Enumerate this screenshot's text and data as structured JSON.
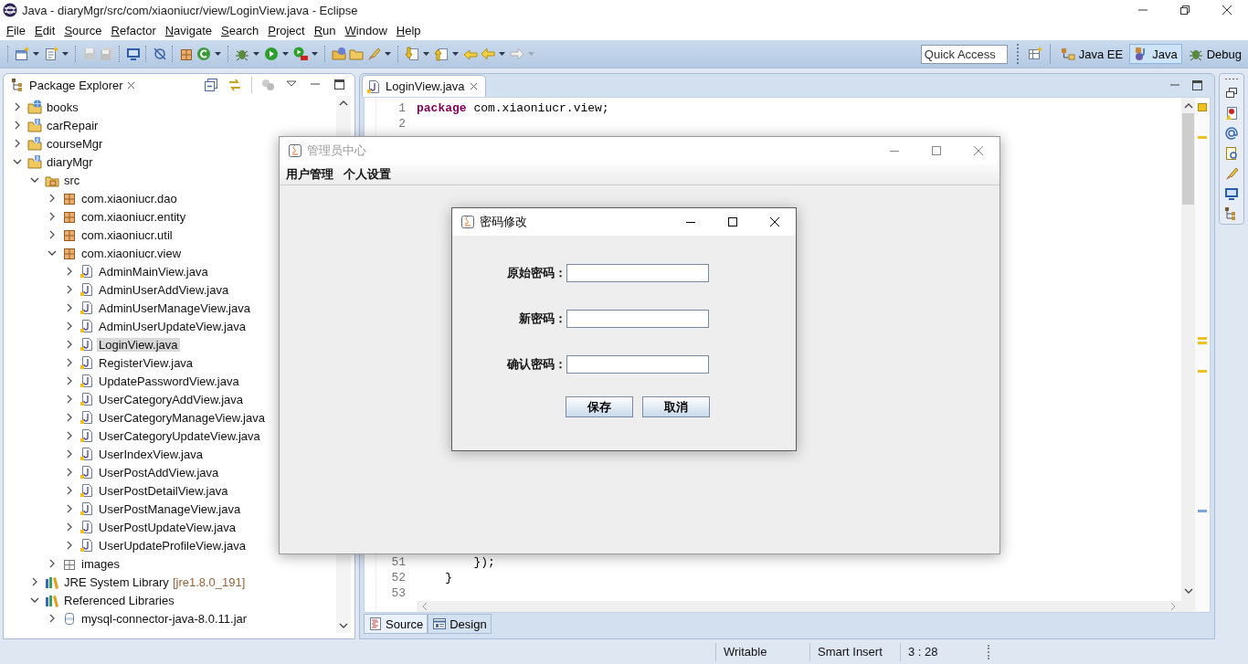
{
  "window": {
    "title": "Java - diaryMgr/src/com/xiaoniucr/view/LoginView.java - Eclipse"
  },
  "menu": [
    "File",
    "Edit",
    "Source",
    "Refactor",
    "Navigate",
    "Search",
    "Project",
    "Run",
    "Window",
    "Help"
  ],
  "quick_access": {
    "placeholder": "Quick Access"
  },
  "perspectives": [
    {
      "label": "Java EE",
      "kind": "javaee",
      "selected": false
    },
    {
      "label": "Java",
      "kind": "java",
      "selected": true
    },
    {
      "label": "Debug",
      "kind": "debug",
      "selected": false
    }
  ],
  "package_explorer": {
    "title": "Package Explorer",
    "tree": [
      {
        "label": "books",
        "kind": "web-project",
        "expanded": false,
        "selected": false
      },
      {
        "label": "carRepair",
        "kind": "project",
        "expanded": false,
        "selected": false
      },
      {
        "label": "courseMgr",
        "kind": "project",
        "expanded": false,
        "selected": false
      },
      {
        "label": "diaryMgr",
        "kind": "project",
        "expanded": true,
        "selected": false,
        "children": [
          {
            "label": "src",
            "kind": "source-folder",
            "expanded": true,
            "selected": false,
            "children": [
              {
                "label": "com.xiaoniucr.dao",
                "kind": "package",
                "expanded": false,
                "selected": false
              },
              {
                "label": "com.xiaoniucr.entity",
                "kind": "package",
                "expanded": false,
                "selected": false
              },
              {
                "label": "com.xiaoniucr.util",
                "kind": "package",
                "expanded": false,
                "selected": false
              },
              {
                "label": "com.xiaoniucr.view",
                "kind": "package",
                "expanded": true,
                "selected": false,
                "children": [
                  {
                    "label": "AdminMainView.java",
                    "kind": "java-file",
                    "expanded": false,
                    "selected": false
                  },
                  {
                    "label": "AdminUserAddView.java",
                    "kind": "java-file",
                    "expanded": false,
                    "selected": false
                  },
                  {
                    "label": "AdminUserManageView.java",
                    "kind": "java-file",
                    "expanded": false,
                    "selected": false
                  },
                  {
                    "label": "AdminUserUpdateView.java",
                    "kind": "java-file",
                    "expanded": false,
                    "selected": false
                  },
                  {
                    "label": "LoginView.java",
                    "kind": "java-file",
                    "expanded": false,
                    "selected": true
                  },
                  {
                    "label": "RegisterView.java",
                    "kind": "java-file",
                    "expanded": false,
                    "selected": false
                  },
                  {
                    "label": "UpdatePasswordView.java",
                    "kind": "java-file",
                    "expanded": false,
                    "selected": false
                  },
                  {
                    "label": "UserCategoryAddView.java",
                    "kind": "java-file",
                    "expanded": false,
                    "selected": false
                  },
                  {
                    "label": "UserCategoryManageView.java",
                    "kind": "java-file",
                    "expanded": false,
                    "selected": false
                  },
                  {
                    "label": "UserCategoryUpdateView.java",
                    "kind": "java-file",
                    "expanded": false,
                    "selected": false
                  },
                  {
                    "label": "UserIndexView.java",
                    "kind": "java-file",
                    "expanded": false,
                    "selected": false
                  },
                  {
                    "label": "UserPostAddView.java",
                    "kind": "java-file",
                    "expanded": false,
                    "selected": false
                  },
                  {
                    "label": "UserPostDetailView.java",
                    "kind": "java-file",
                    "expanded": false,
                    "selected": false
                  },
                  {
                    "label": "UserPostManageView.java",
                    "kind": "java-file",
                    "expanded": false,
                    "selected": false
                  },
                  {
                    "label": "UserPostUpdateView.java",
                    "kind": "java-file",
                    "expanded": false,
                    "selected": false
                  },
                  {
                    "label": "UserUpdateProfileView.java",
                    "kind": "java-file",
                    "expanded": false,
                    "selected": false
                  }
                ]
              },
              {
                "label": "images",
                "kind": "folder",
                "expanded": false,
                "selected": false
              }
            ]
          },
          {
            "label": "JRE System Library",
            "decoration": "[jre1.8.0_191]",
            "kind": "library",
            "expanded": false,
            "selected": false
          },
          {
            "label": "Referenced Libraries",
            "kind": "library",
            "expanded": true,
            "selected": false,
            "children": [
              {
                "label": "mysql-connector-java-8.0.11.jar",
                "kind": "jar",
                "expanded": false,
                "selected": false
              }
            ]
          }
        ]
      }
    ]
  },
  "editor": {
    "tab": {
      "label": "LoginView.java"
    },
    "top_lines": [
      {
        "number": "1",
        "tokens": [
          {
            "text": "package",
            "kind": "keyword"
          },
          {
            "text": " com.xiaoniucr.view;",
            "kind": "plain"
          }
        ]
      },
      {
        "number": "2"
      }
    ],
    "bottom_lines": [
      {
        "number": "51",
        "tokens": [
          {
            "text": "        });",
            "kind": "plain"
          }
        ]
      },
      {
        "number": "52",
        "tokens": [
          {
            "text": "    }",
            "kind": "plain"
          }
        ]
      },
      {
        "number": "53"
      }
    ],
    "bottom_tabs": [
      {
        "label": "Source",
        "kind": "source",
        "selected": true
      },
      {
        "label": "Design",
        "kind": "design",
        "selected": false
      }
    ]
  },
  "status_bar": [
    "Writable",
    "Smart Insert",
    "3 : 28"
  ],
  "admin_window": {
    "title": "管理员中心",
    "menu": [
      "用户管理",
      "个人设置"
    ]
  },
  "dialog": {
    "title": "密码修改",
    "fields": [
      {
        "label": "原始密码："
      },
      {
        "label": "新密码："
      },
      {
        "label": "确认密码："
      }
    ],
    "buttons": [
      "保存",
      "取消"
    ]
  }
}
